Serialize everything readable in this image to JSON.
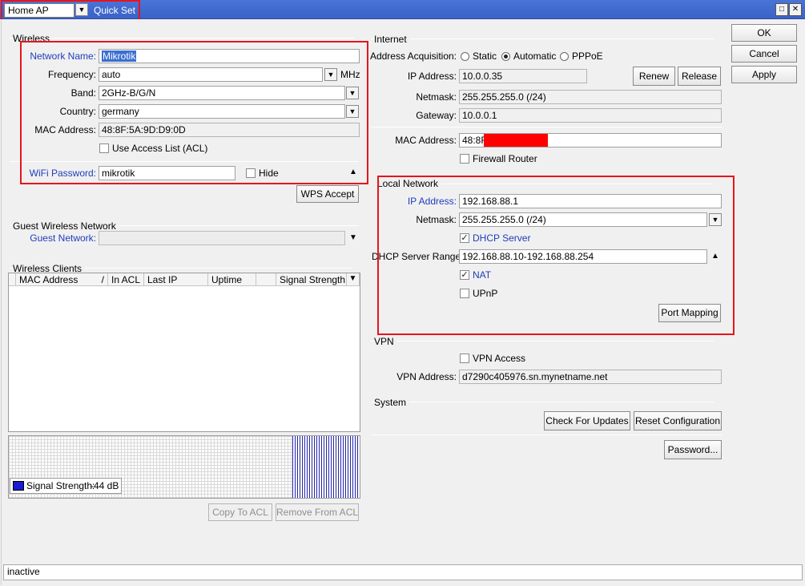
{
  "titlebar": {
    "mode_value": "Home AP",
    "title": "Quick Set"
  },
  "buttons_right": {
    "ok": "OK",
    "cancel": "Cancel",
    "apply": "Apply"
  },
  "wireless": {
    "section": "Wireless",
    "network_name_label": "Network Name:",
    "network_name_value": "Mikrotik",
    "frequency_label": "Frequency:",
    "frequency_value": "auto",
    "frequency_unit": "MHz",
    "band_label": "Band:",
    "band_value": "2GHz-B/G/N",
    "country_label": "Country:",
    "country_value": "germany",
    "mac_label": "MAC Address:",
    "mac_value": "48:8F:5A:9D:D9:0D",
    "acl_label": "Use Access List (ACL)",
    "wifi_password_label": "WiFi Password:",
    "wifi_password_value": "mikrotik",
    "hide_label": "Hide",
    "wps_button": "WPS Accept"
  },
  "guest": {
    "section": "Guest Wireless Network",
    "label": "Guest Network:",
    "value": ""
  },
  "clients": {
    "section": "Wireless Clients",
    "columns": [
      "MAC Address",
      "In ACL",
      "Last IP",
      "Uptime",
      "Signal Strength"
    ],
    "signal_label": "Signal Strength:",
    "signal_value": "-44 dB",
    "copy_acl": "Copy To ACL",
    "remove_acl": "Remove From ACL"
  },
  "internet": {
    "section": "Internet",
    "acq_label": "Address Acquisition:",
    "opt_static": "Static",
    "opt_automatic": "Automatic",
    "opt_pppoe": "PPPoE",
    "ip_label": "IP Address:",
    "ip_value": "10.0.0.35",
    "renew": "Renew",
    "release": "Release",
    "netmask_label": "Netmask:",
    "netmask_value": "255.255.255.0 (/24)",
    "gateway_label": "Gateway:",
    "gateway_value": "10.0.0.1",
    "mac_label": "MAC Address:",
    "mac_value": "48:8F",
    "firewall_label": "Firewall Router"
  },
  "local": {
    "section": "Local Network",
    "ip_label": "IP Address:",
    "ip_value": "192.168.88.1",
    "netmask_label": "Netmask:",
    "netmask_value": "255.255.255.0 (/24)",
    "dhcp_label": "DHCP Server",
    "range_label": "DHCP Server Range:",
    "range_value": "192.168.88.10-192.168.88.254",
    "nat_label": "NAT",
    "upnp_label": "UPnP",
    "port_mapping": "Port Mapping"
  },
  "vpn": {
    "section": "VPN",
    "access_label": "VPN Access",
    "address_label": "VPN Address:",
    "address_value": "d7290c405976.sn.mynetname.net"
  },
  "system": {
    "section": "System",
    "check_updates": "Check For Updates",
    "reset_config": "Reset Configuration",
    "password": "Password..."
  },
  "status": {
    "text": "inactive"
  },
  "colors": {
    "highlight_box": "#e8141c",
    "title_blue": "#3a62c7",
    "link_blue": "#1f3dbd"
  }
}
